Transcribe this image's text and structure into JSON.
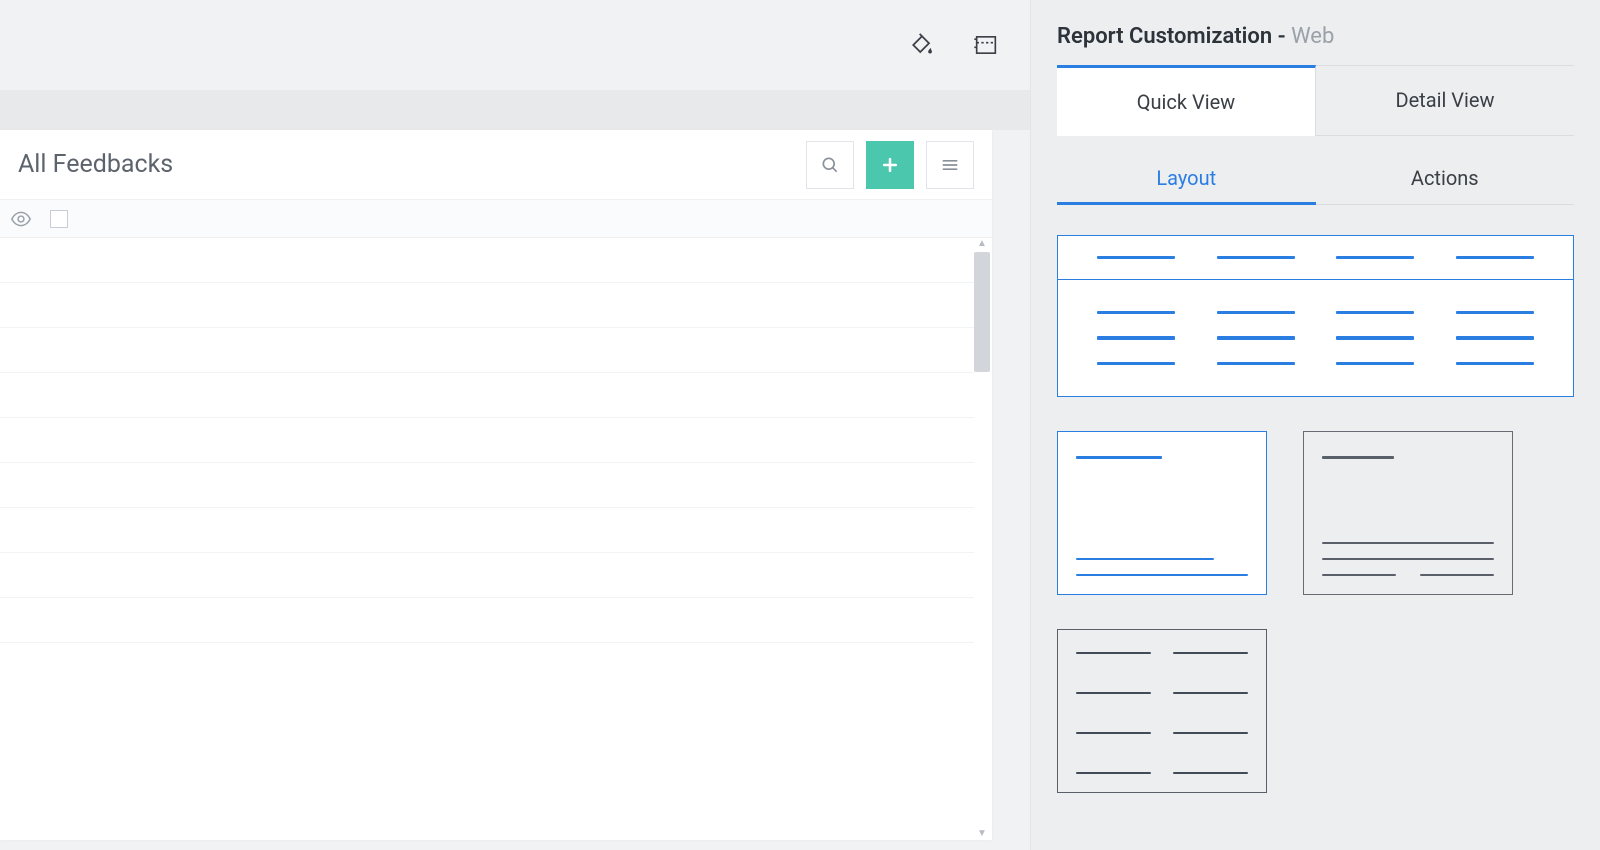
{
  "panel": {
    "title_main": "Report Customization - ",
    "title_sub": "Web",
    "view_tabs": [
      {
        "label": "Quick View",
        "active": true
      },
      {
        "label": "Detail View",
        "active": false
      }
    ],
    "subtabs": [
      {
        "label": "Layout",
        "active": true
      },
      {
        "label": "Actions",
        "active": false
      }
    ]
  },
  "report": {
    "title": "All Feedbacks"
  },
  "colors": {
    "accent": "#2a7ee2",
    "success": "#4bc7ae"
  }
}
